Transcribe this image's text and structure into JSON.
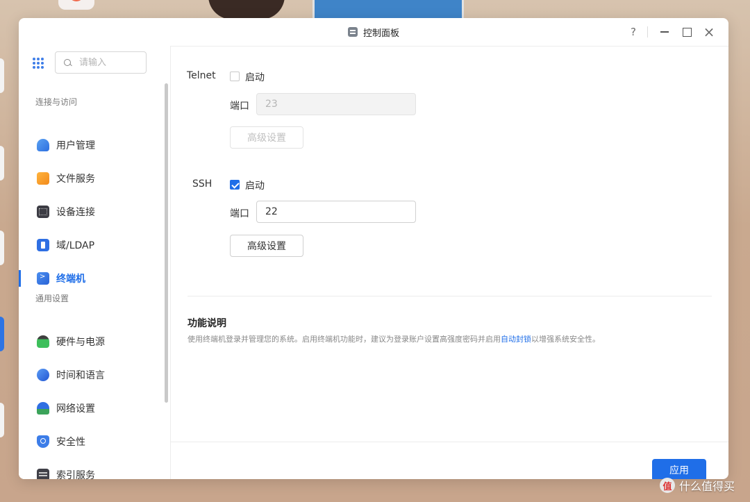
{
  "window": {
    "title": "控制面板",
    "controls": {
      "help": "?",
      "close": "×"
    }
  },
  "search": {
    "placeholder": "请输入"
  },
  "sidebar": {
    "section_connect": "连接与访问",
    "section_general": "通用设置",
    "items": [
      {
        "label": "用户管理",
        "icon": "user-icon"
      },
      {
        "label": "文件服务",
        "icon": "folder-icon"
      },
      {
        "label": "设备连接",
        "icon": "device-icon"
      },
      {
        "label": "域/LDAP",
        "icon": "ldap-icon"
      },
      {
        "label": "终端机",
        "icon": "terminal-icon",
        "active": true
      },
      {
        "label": "硬件与电源",
        "icon": "hardware-icon"
      },
      {
        "label": "时间和语言",
        "icon": "clock-icon"
      },
      {
        "label": "网络设置",
        "icon": "network-icon"
      },
      {
        "label": "安全性",
        "icon": "shield-icon"
      },
      {
        "label": "索引服务",
        "icon": "index-icon"
      }
    ]
  },
  "telnet": {
    "label": "Telnet",
    "enable_label": "启动",
    "enabled": false,
    "port_label": "端口",
    "port_value": "23",
    "advanced_label": "高级设置"
  },
  "ssh": {
    "label": "SSH",
    "enable_label": "启动",
    "enabled": true,
    "port_label": "端口",
    "port_value": "22",
    "advanced_label": "高级设置"
  },
  "description": {
    "title": "功能说明",
    "text_before": "使用终端机登录并管理您的系统。启用终端机功能时，建议为登录账户设置高强度密码并启用",
    "link": "自动封锁",
    "text_after": "以增强系统安全性。"
  },
  "footer": {
    "apply_label": "应用"
  },
  "watermark": {
    "logo": "值",
    "text": "什么值得买"
  },
  "colors": {
    "accent": "#1f6ee8"
  }
}
